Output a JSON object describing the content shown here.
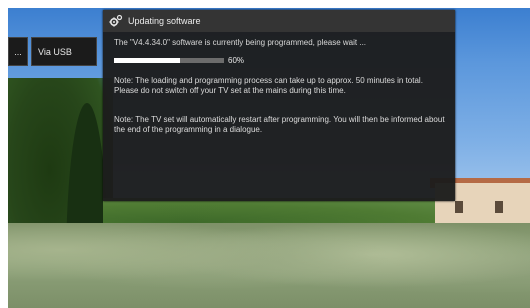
{
  "left_menu": {
    "items": [
      {
        "label": "..."
      },
      {
        "label": "Via USB"
      }
    ]
  },
  "dialog": {
    "title": "Updating software",
    "icon": "gear-icon",
    "status": "The \"V4.4.34.0\" software is currently being programmed, please wait ...",
    "progress": {
      "value": 0.6,
      "label": "60%"
    },
    "note1": "Note: The loading and programming process can take up to approx. 50 minutes in total. Please do not switch off your TV set at the mains during this time.",
    "note2": "Note: The TV set will automatically restart after programming. You will then be informed about the end of the programming in a dialogue."
  },
  "colors": {
    "dialog_bg": "#1c1c1c",
    "header_bg": "#343434",
    "progress_fill": "#ffffff",
    "progress_track": "#6c6c6c"
  }
}
